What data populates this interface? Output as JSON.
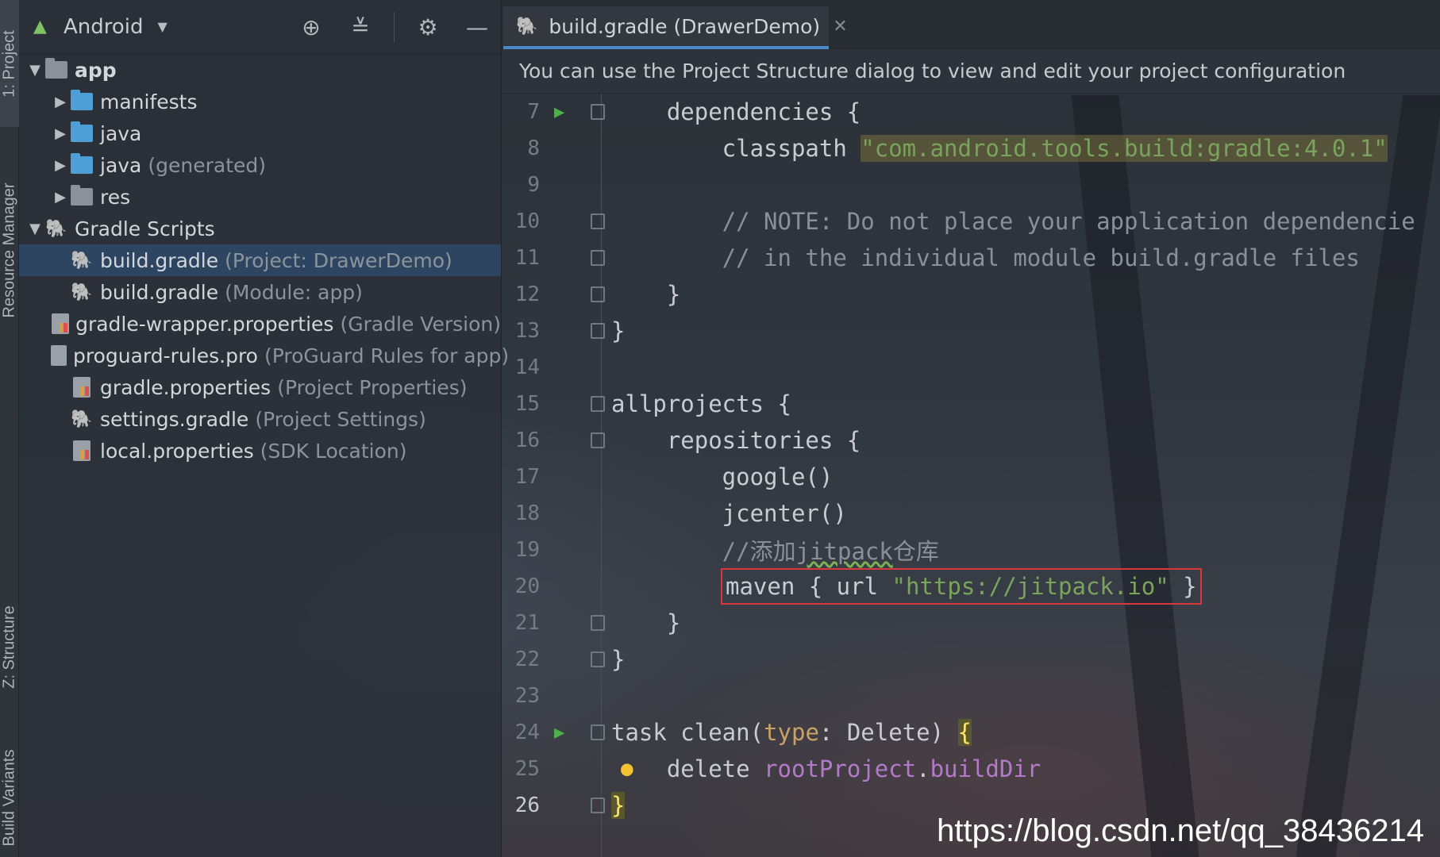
{
  "sidebar_tabs": {
    "project": "1: Project",
    "resource_manager": "Resource Manager",
    "structure": "Z: Structure",
    "build_variants": "Build Variants"
  },
  "project_panel": {
    "view_mode": "Android",
    "tree": [
      {
        "name": "app",
        "hint": "",
        "level": 0,
        "expanded": true,
        "icon": "module-folder-icon"
      },
      {
        "name": "manifests",
        "hint": "",
        "level": 1,
        "expanded": false,
        "icon": "folder-icon"
      },
      {
        "name": "java",
        "hint": "",
        "level": 1,
        "expanded": false,
        "icon": "folder-icon"
      },
      {
        "name": "java",
        "hint": "(generated)",
        "level": 1,
        "expanded": false,
        "icon": "generated-folder-icon"
      },
      {
        "name": "res",
        "hint": "",
        "level": 1,
        "expanded": false,
        "icon": "res-folder-icon"
      },
      {
        "name": "Gradle Scripts",
        "hint": "",
        "level": 0,
        "expanded": true,
        "icon": "gradle-icon"
      },
      {
        "name": "build.gradle",
        "hint": "(Project: DrawerDemo)",
        "level": 1,
        "selected": true,
        "icon": "gradle-icon"
      },
      {
        "name": "build.gradle",
        "hint": "(Module: app)",
        "level": 1,
        "icon": "gradle-icon"
      },
      {
        "name": "gradle-wrapper.properties",
        "hint": "(Gradle Version)",
        "level": 1,
        "icon": "properties-icon"
      },
      {
        "name": "proguard-rules.pro",
        "hint": "(ProGuard Rules for app)",
        "level": 1,
        "icon": "file-icon"
      },
      {
        "name": "gradle.properties",
        "hint": "(Project Properties)",
        "level": 1,
        "icon": "properties-icon"
      },
      {
        "name": "settings.gradle",
        "hint": "(Project Settings)",
        "level": 1,
        "icon": "gradle-icon"
      },
      {
        "name": "local.properties",
        "hint": "(SDK Location)",
        "level": 1,
        "icon": "properties-icon"
      }
    ]
  },
  "editor": {
    "tab_label": "build.gradle (DrawerDemo)",
    "notice": "You can use the Project Structure dialog to view and edit your project configuration",
    "lines": {
      "l7": {
        "n": "7",
        "text": "    dependencies {"
      },
      "l8": {
        "n": "8",
        "pre": "        classpath ",
        "str": "\"com.android.tools.build:gradle:4.0.1\""
      },
      "l9": {
        "n": "9"
      },
      "l10": {
        "n": "10",
        "text": "        // NOTE: Do not place your application dependencie"
      },
      "l11": {
        "n": "11",
        "text": "        // in the individual module build.gradle files"
      },
      "l12": {
        "n": "12",
        "text": "    }"
      },
      "l13": {
        "n": "13",
        "text": "}"
      },
      "l14": {
        "n": "14"
      },
      "l15": {
        "n": "15",
        "text": "allprojects {"
      },
      "l16": {
        "n": "16",
        "text": "    repositories {"
      },
      "l17": {
        "n": "17",
        "text": "        google()"
      },
      "l18": {
        "n": "18",
        "text": "        jcenter()"
      },
      "l19": {
        "n": "19",
        "pre": "        //添加",
        "squig": "jitpack",
        "post": "仓库"
      },
      "l20": {
        "n": "20",
        "pre": "maven { url ",
        "str": "\"https://jitpack.io\"",
        "post": " }"
      },
      "l21": {
        "n": "21",
        "text": "    }"
      },
      "l22": {
        "n": "22",
        "text": "}"
      },
      "l23": {
        "n": "23"
      },
      "l24": {
        "n": "24",
        "pre": "task clean(",
        "kw": "type",
        "mid": ": Delete) ",
        "brace": "{"
      },
      "l25": {
        "n": "25",
        "pre": "    delete ",
        "prop": "rootProject",
        "post": ".",
        "prop2": "buildDir"
      },
      "l26": {
        "n": "26",
        "brace": "}"
      }
    }
  },
  "watermark": "https://blog.csdn.net/qq_38436214"
}
